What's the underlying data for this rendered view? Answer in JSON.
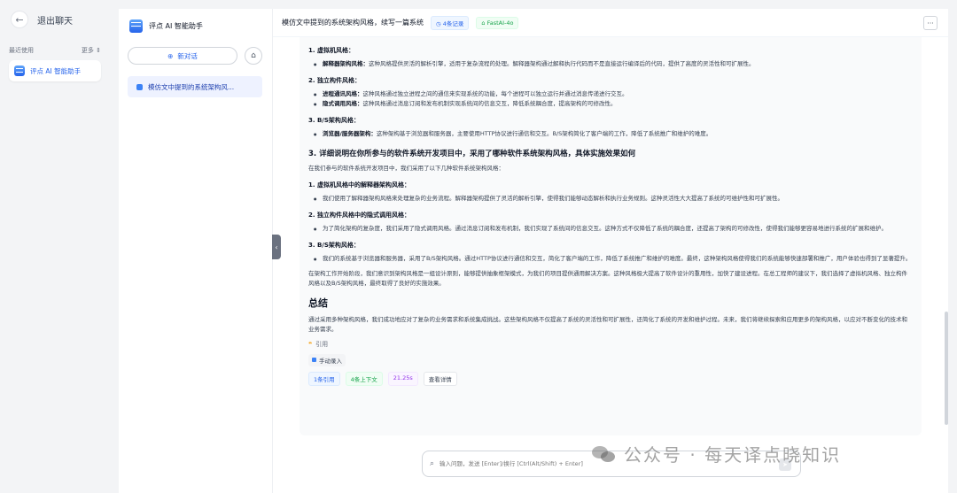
{
  "sidebar": {
    "exit_label": "退出聊天",
    "recent_label": "最近使用",
    "more_label": "更多 ⇕",
    "app_item": "评点 AI 智能助手"
  },
  "chat_panel": {
    "app_name": "评点 AI 智能助手",
    "new_chat": "新对话",
    "conversation": "模仿文中提到的系统架构风..."
  },
  "topbar": {
    "title": "模仿文中提到的系统架构风格，续写一篇系统",
    "records_tag": "4条记录",
    "model_tag": "FastAI-4o",
    "more": "···"
  },
  "content": {
    "s1_h": "1. 虚拟机风格：",
    "s1_b1_bold": "解释器架构风格：",
    "s1_b1": "这种风格提供灵活的解析引擎，适用于复杂流程的处理。解释器架构通过解释执行代码而不是直接运行编译后的代码，提供了高度的灵活性和可扩展性。",
    "s2_h": "2. 独立构件风格：",
    "s2_b1_bold": "进程通讯风格：",
    "s2_b1": "这种风格通过独立进程之间的通信来实现系统的功能，每个进程可以独立运行并通过消息传递进行交互。",
    "s2_b2_bold": "隐式调用风格：",
    "s2_b2": "这种风格通过消息订阅和发布机制实现系统间的信息交互，降低系统耦合度，提高架构的可修改性。",
    "s3_h": "3. B/S架构风格：",
    "s3_b1_bold": "浏览器/服务器架构：",
    "s3_b1": "这种架构基于浏览器和服务器，主要使用HTTP协议进行通信和交互。B/S架构简化了客户端的工作，降低了系统推广和维护的难度。",
    "q3_h": "3. 详细说明在你所参与的软件系统开发项目中，采用了哪种软件系统架构风格，具体实施效果如何",
    "q3_p": "在我们参与的软件系统开发项目中，我们采用了以下几种软件系统架构风格：",
    "t1_h": "1. 虚拟机风格中的解释器架构风格：",
    "t1_b": "我们使用了解释器架构风格来处理复杂的业务流程。解释器架构提供了灵活的解析引擎，使得我们能够动态解析和执行业务规则。这种灵活性大大提高了系统的可维护性和可扩展性。",
    "t2_h": "2. 独立构件风格中的隐式调用风格：",
    "t2_b": "为了简化架构的复杂度，我们采用了隐式调用风格。通过消息订阅和发布机制，我们实现了系统间的信息交互。这种方式不仅降低了系统的耦合度，还提高了架构的可修改性，使得我们能够更容易地进行系统的扩展和维护。",
    "t3_h": "3. B/S架构风格：",
    "t3_b": "我们的系统基于浏览器和服务器，采用了B/S架构风格。通过HTTP协议进行通信和交互，简化了客户端的工作，降低了系统推广和维护的难度。最终，这种架构风格使得我们的系统能够快速部署和推广，用户体验也得到了显著提升。",
    "p_end": "在架构工作开始阶段，我们意识到架构风格是一组设计原则，能够提供抽象框架模式，为我们的项目提供通用解决方案。这种风格极大提高了软件设计的重用性，加快了建设进程。在总工程师的建议下，我们选择了虚拟机风格、独立构件风格以及B/S架构风格，最终取得了良好的实施效果。",
    "summary_h": "总结",
    "summary_p": "通过采用多种架构风格，我们成功地应对了复杂的业务需求和系统集成挑战。这些架构风格不仅提高了系统的灵活性和可扩展性，还简化了系统的开发和维护过程。未来，我们将继续探索和应用更多的架构风格，以应对不断变化的技术和业务需求。",
    "cite_label": "引用",
    "cite_chip": "手动录入",
    "chip1": "1条引用",
    "chip2": "4条上下文",
    "chip3": "21.25s",
    "chip4": "查看详情"
  },
  "input": {
    "placeholder": "输入问题，发送 [Enter]/换行 [Ctrl(Alt/Shift) + Enter]"
  },
  "watermark": "公众号 · 每天译点晓知识"
}
